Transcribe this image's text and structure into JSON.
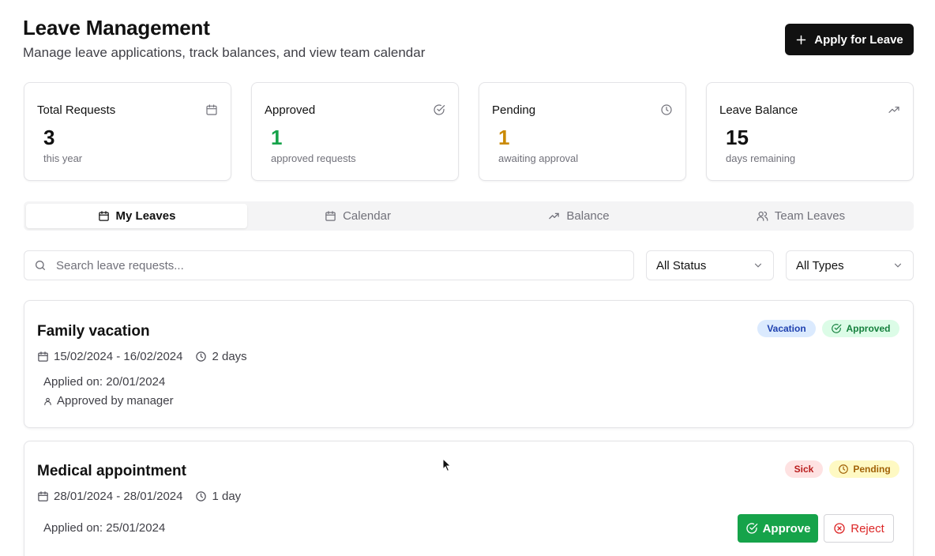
{
  "header": {
    "title": "Leave Management",
    "subtitle": "Manage leave applications, track balances, and view team calendar",
    "apply_label": "Apply for Leave"
  },
  "stats": [
    {
      "label": "Total Requests",
      "value": "3",
      "note": "this year",
      "icon": "calendar-icon",
      "color": "#111111"
    },
    {
      "label": "Approved",
      "value": "1",
      "note": "approved requests",
      "icon": "check-circle-icon",
      "color": "#16a34a"
    },
    {
      "label": "Pending",
      "value": "1",
      "note": "awaiting approval",
      "icon": "clock-icon",
      "color": "#ca8a04"
    },
    {
      "label": "Leave Balance",
      "value": "15",
      "note": "days remaining",
      "icon": "trending-up-icon",
      "color": "#111111"
    }
  ],
  "tabs": [
    {
      "label": "My Leaves",
      "icon": "calendar-icon",
      "active": true
    },
    {
      "label": "Calendar",
      "icon": "calendar-icon",
      "active": false
    },
    {
      "label": "Balance",
      "icon": "trending-up-icon",
      "active": false
    },
    {
      "label": "Team Leaves",
      "icon": "users-icon",
      "active": false
    }
  ],
  "filters": {
    "search_placeholder": "Search leave requests...",
    "status_selected": "All Status",
    "type_selected": "All Types"
  },
  "leaves": [
    {
      "title": "Family vacation",
      "dates": "15/02/2024 - 16/02/2024",
      "duration": "2 days",
      "applied": "Applied on: 20/01/2024",
      "approved_by": "Approved by manager",
      "type_badge": "Vacation",
      "status_badge": "Approved"
    },
    {
      "title": "Medical appointment",
      "dates": "28/01/2024 - 28/01/2024",
      "duration": "1 day",
      "applied": "Applied on: 25/01/2024",
      "type_badge": "Sick",
      "status_badge": "Pending",
      "approve_label": "Approve",
      "reject_label": "Reject"
    }
  ],
  "colors": {
    "approved_green": "#16a34a",
    "pending_amber": "#ca8a04",
    "primary_black": "#111111"
  }
}
